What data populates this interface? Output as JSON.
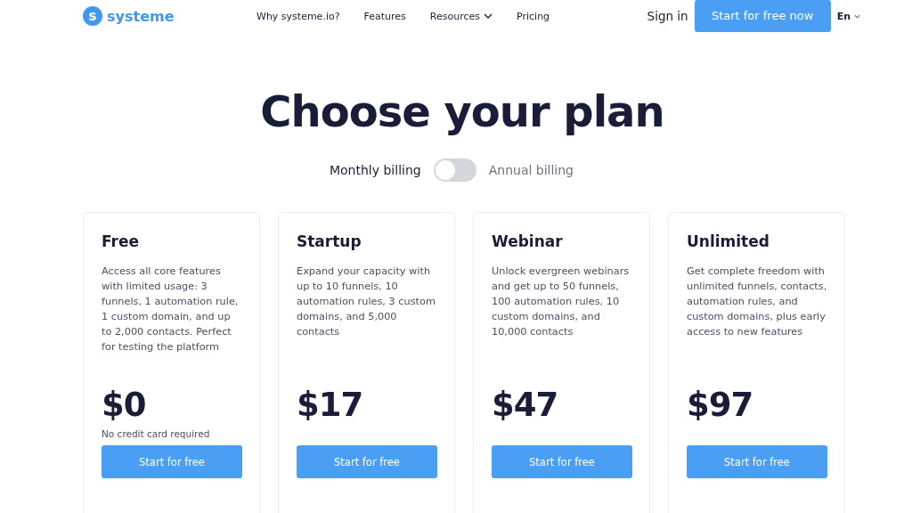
{
  "header": {
    "logo": {
      "mark": "s",
      "name": "systeme"
    },
    "nav": [
      {
        "label": "Why systeme.io?",
        "dropdown": false
      },
      {
        "label": "Features",
        "dropdown": false
      },
      {
        "label": "Resources",
        "dropdown": true
      },
      {
        "label": "Pricing",
        "dropdown": false
      }
    ],
    "sign_in": "Sign in",
    "cta": "Start for free now",
    "language": "En"
  },
  "title": "Choose your plan",
  "billing": {
    "monthly_label": "Monthly billing",
    "annual_label": "Annual billing",
    "annual": false
  },
  "plans": [
    {
      "name": "Free",
      "description": "Access all core features with limited usage: 3 funnels, 1 automation rule, 1 custom domain, and up to 2,000 contacts. Perfect for testing the platform",
      "price": "$0",
      "note": "No credit card required",
      "button": "Start for free"
    },
    {
      "name": "Startup",
      "description": "Expand your capacity with up to 10 funnels, 10 automation rules, 3 custom domains, and 5,000 contacts",
      "price": "$17",
      "button": "Start for free"
    },
    {
      "name": "Webinar",
      "description": "Unlock evergreen webinars and get up to 50 funnels, 100 automation rules, 10 custom domains, and 10,000 contacts",
      "price": "$47",
      "button": "Start for free"
    },
    {
      "name": "Unlimited",
      "description": "Get complete freedom with unlimited funnels, contacts, automation rules, and custom domains, plus early access to new features",
      "price": "$97",
      "button": "Start for free"
    }
  ]
}
